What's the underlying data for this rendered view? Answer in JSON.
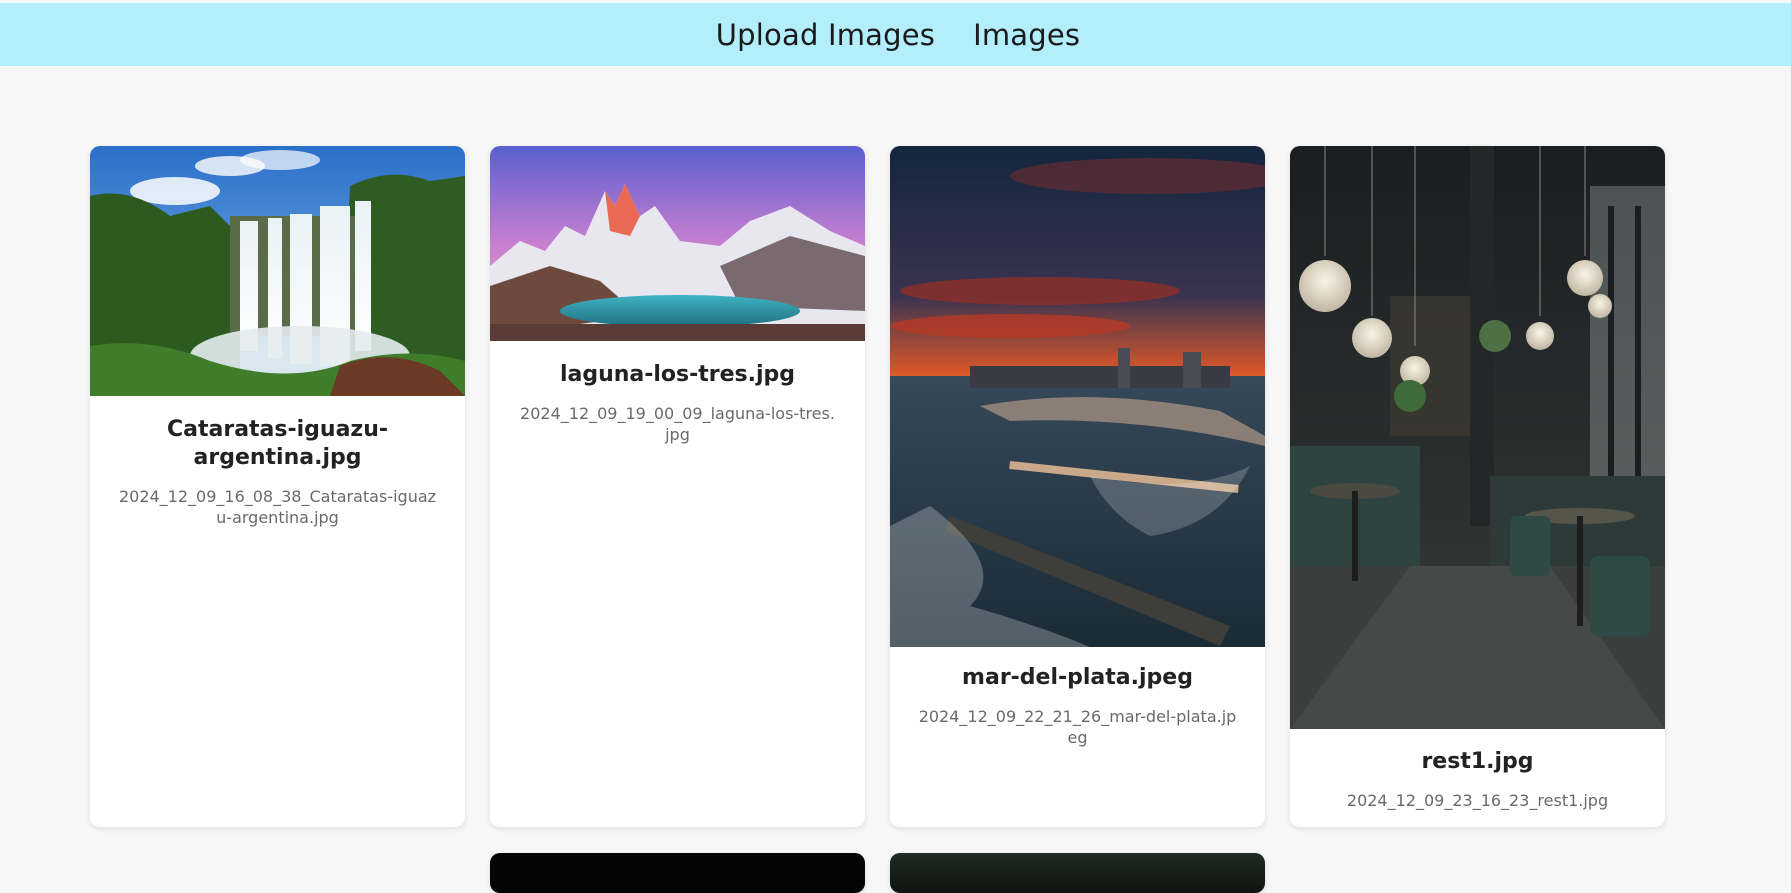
{
  "nav": {
    "upload_label": "Upload Images",
    "images_label": "Images",
    "background_color": "#b3eefc"
  },
  "cards": [
    {
      "title": "Cataratas-iguazu-argentina.jpg",
      "filename": "2024_12_09_16_08_38_Cataratas-iguazu-argentina.jpg",
      "image_subject": "waterfall-landscape"
    },
    {
      "title": "laguna-los-tres.jpg",
      "filename": "2024_12_09_19_00_09_laguna-los-tres.jpg",
      "image_subject": "mountain-lake-sunset"
    },
    {
      "title": "mar-del-plata.jpeg",
      "filename": "2024_12_09_22_21_26_mar-del-plata.jpeg",
      "image_subject": "coastal-city-sunset"
    },
    {
      "title": "rest1.jpg",
      "filename": "2024_12_09_23_16_23_rest1.jpg",
      "image_subject": "restaurant-interior"
    }
  ]
}
